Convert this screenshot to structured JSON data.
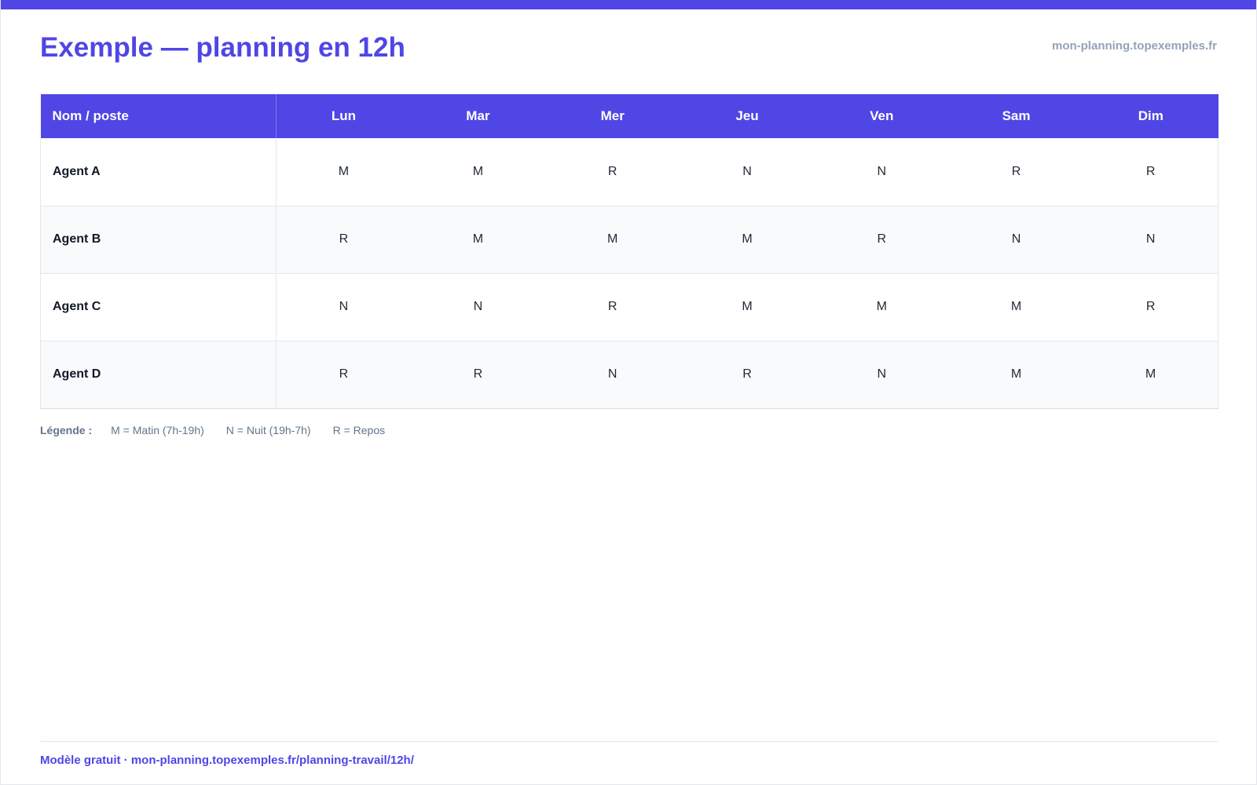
{
  "header": {
    "title": "Exemple — planning en 12h",
    "site": "mon-planning.topexemples.fr"
  },
  "colors": {
    "accent": "#4f46e5",
    "row_alt": "#f8fafc",
    "muted": "#94a3b8"
  },
  "table": {
    "name_header": "Nom / poste",
    "days": [
      "Lun",
      "Mar",
      "Mer",
      "Jeu",
      "Ven",
      "Sam",
      "Dim"
    ],
    "rows": [
      {
        "name": "Agent A",
        "shifts": [
          "M",
          "M",
          "R",
          "N",
          "N",
          "R",
          "R"
        ]
      },
      {
        "name": "Agent B",
        "shifts": [
          "R",
          "M",
          "M",
          "M",
          "R",
          "N",
          "N"
        ]
      },
      {
        "name": "Agent C",
        "shifts": [
          "N",
          "N",
          "R",
          "M",
          "M",
          "M",
          "R"
        ]
      },
      {
        "name": "Agent D",
        "shifts": [
          "R",
          "R",
          "N",
          "R",
          "N",
          "M",
          "M"
        ]
      }
    ]
  },
  "legend": {
    "title": "Légende :",
    "items": [
      "M = Matin (7h-19h)",
      "N = Nuit (19h-7h)",
      "R = Repos"
    ]
  },
  "footer": {
    "text": "Modèle gratuit · mon-planning.topexemples.fr/planning-travail/12h/"
  }
}
